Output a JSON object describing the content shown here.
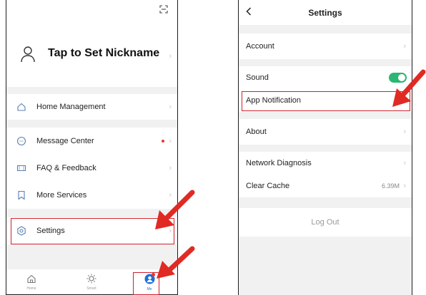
{
  "left_screen": {
    "profile": {
      "nickname": "Tap to Set Nickname"
    },
    "menu": {
      "home_management": "Home Management",
      "message_center": "Message Center",
      "faq_feedback": "FAQ & Feedback",
      "more_services": "More Services",
      "settings": "Settings"
    },
    "tabs": [
      {
        "label": "Home",
        "icon": "house-icon",
        "active": false
      },
      {
        "label": "Smart",
        "icon": "sun-icon",
        "active": false
      },
      {
        "label": "Me",
        "icon": "person-icon",
        "active": true
      }
    ]
  },
  "right_screen": {
    "header": {
      "title": "Settings",
      "back_icon": "chevron-left-icon"
    },
    "items": {
      "account": "Account",
      "sound": "Sound",
      "sound_enabled": true,
      "app_notification": "App Notification",
      "about": "About",
      "network_diagnosis": "Network Diagnosis",
      "clear_cache": "Clear Cache",
      "cache_size": "6.39M"
    },
    "log_out": "Log Out"
  },
  "colors": {
    "highlight_border": "#d0202a",
    "arrow": "#e02a24",
    "toggle_on": "#2bb673",
    "active_tab": "#1d6fd6",
    "badge": "#e8352f"
  }
}
